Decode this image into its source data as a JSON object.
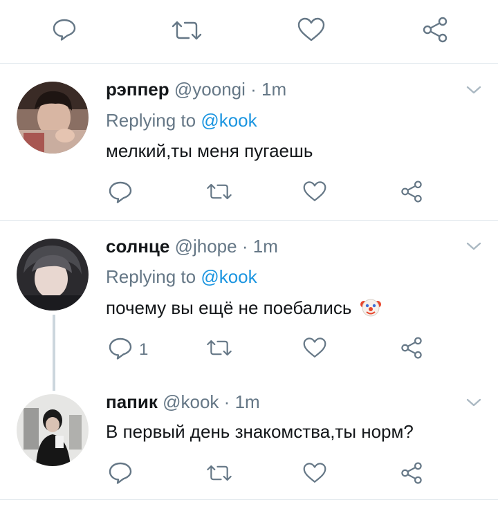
{
  "top_actions": [
    "reply-icon",
    "retweet-icon",
    "like-icon",
    "share-icon"
  ],
  "tweets": [
    {
      "display_name": "рэппер",
      "handle": "@yoongi",
      "separator": "·",
      "time": "1m",
      "replying_prefix": "Replying to",
      "replying_to": "@kook",
      "text": "мелкий,ты меня пугаешь",
      "reply_count": ""
    },
    {
      "display_name": "солнце",
      "handle": "@jhope",
      "separator": "·",
      "time": "1m",
      "replying_prefix": "Replying to",
      "replying_to": "@kook",
      "text": "почему вы ещё не поебались",
      "emoji": "clown-face",
      "reply_count": "1"
    },
    {
      "display_name": "папик",
      "handle": "@kook",
      "separator": "·",
      "time": "1m",
      "text": "В первый день знакомства,ты норм?",
      "reply_count": ""
    }
  ],
  "colors": {
    "icon": "#657786",
    "mention": "#1b95e0",
    "divider": "#e1e8ed",
    "thread_line": "#ccd6dd"
  }
}
